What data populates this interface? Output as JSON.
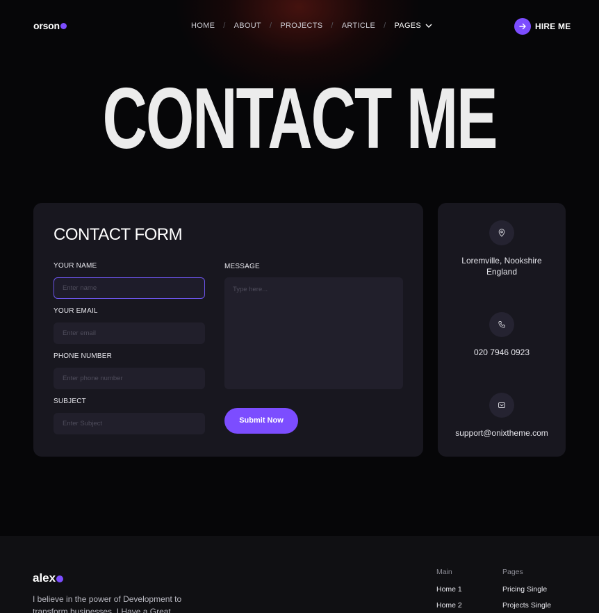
{
  "header": {
    "logo_text": "orson",
    "nav": [
      {
        "label": "HOME"
      },
      {
        "label": "ABOUT"
      },
      {
        "label": "PROJECTS"
      },
      {
        "label": "ARTICLE"
      },
      {
        "label": "PAGES"
      }
    ],
    "nav_separator": "/",
    "hire_label": "HIRE ME"
  },
  "hero": {
    "title": "CONTACT ME"
  },
  "form": {
    "title": "CONTACT FORM",
    "name_label": "YOUR NAME",
    "name_placeholder": "Enter name",
    "email_label": "YOUR EMAIL",
    "email_placeholder": "Enter email",
    "phone_label": "PHONE NUMBER",
    "phone_placeholder": "Enter phone number",
    "subject_label": "SUBJECT",
    "subject_placeholder": "Enter Subject",
    "message_label": "MESSAGE",
    "message_placeholder": "Type here...",
    "submit_label": "Submit Now"
  },
  "info": {
    "address_line1": "Loremville, Nookshire",
    "address_line2": "England",
    "phone": "020 7946 0923",
    "email": "support@onixtheme.com"
  },
  "footer": {
    "logo_text": "alex",
    "description_line1": "I believe in the power of Development to",
    "description_line2": "transform businesses. I Have a Great",
    "col_main": {
      "heading": "Main",
      "items": [
        "Home 1",
        "Home 2"
      ]
    },
    "col_pages": {
      "heading": "Pages",
      "items": [
        "Pricing Single",
        "Projects Single"
      ]
    }
  },
  "colors": {
    "accent": "#7c4dff",
    "card": "#18171f",
    "input": "#211f2b",
    "background": "#060608"
  }
}
